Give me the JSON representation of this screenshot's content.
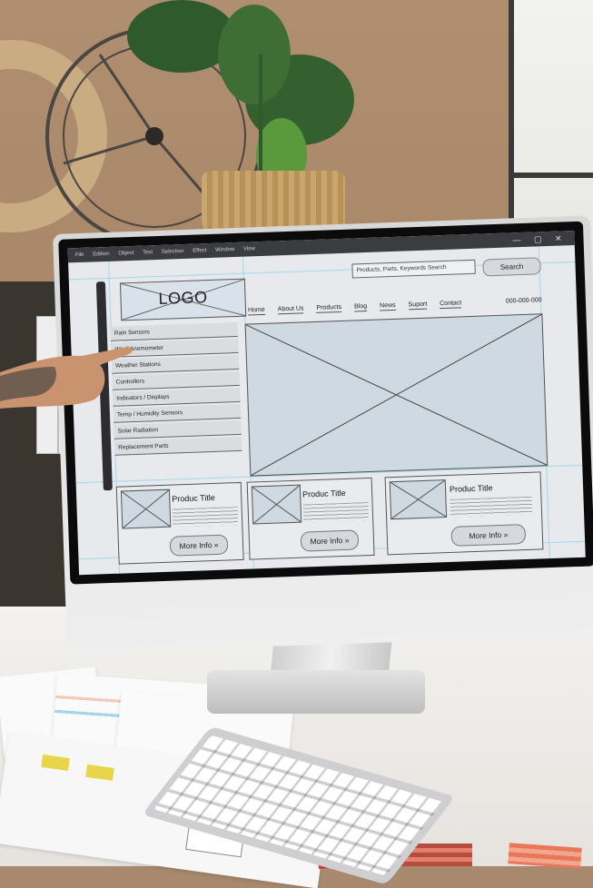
{
  "menubar": {
    "items": [
      "File",
      "Edition",
      "Object",
      "Text",
      "Selection",
      "Effect",
      "Window",
      "View"
    ]
  },
  "window_controls": "— ▢ ✕",
  "logo": {
    "text": "LOGO"
  },
  "search": {
    "placeholder": "Products, Parts, Keywords Search",
    "button": "Search"
  },
  "nav": {
    "items": [
      "Home",
      "About Us",
      "Products",
      "Blog",
      "News",
      "Suport",
      "Contact"
    ]
  },
  "phone": "000-000-000",
  "sidebar": {
    "items": [
      "Rain Sensors",
      "Wind Anemometer",
      "Weather Stations",
      "Controllers",
      "Indicators / Displays",
      "Temp / Humidity Sensors",
      "Solar Radiation",
      "Replacement Parts"
    ]
  },
  "cards": [
    {
      "title": "Produc Title",
      "button": "More Info »"
    },
    {
      "title": "Produc Title",
      "button": "More Info »"
    },
    {
      "title": "Produc Title",
      "button": "More Info »"
    }
  ],
  "colors": {
    "wall": "#a88668",
    "screen": "#e7e9ec",
    "guide": "#7fd4e8",
    "placeholder": "#cfd9e2"
  }
}
